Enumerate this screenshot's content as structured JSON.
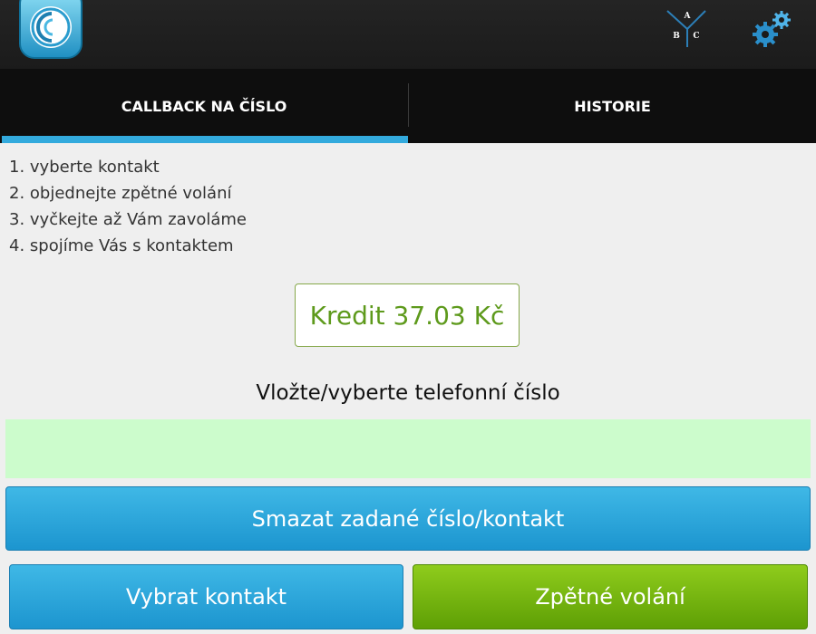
{
  "actionbar": {
    "logo_icon": "app-logo-icon",
    "abc_icon": "abc-contacts-icon",
    "abc_letters": [
      "A",
      "B",
      "C"
    ],
    "settings_icon": "gears-icon"
  },
  "tabs": [
    {
      "label": "CALLBACK NA ČÍSLO",
      "selected": true
    },
    {
      "label": "HISTORIE",
      "selected": false
    }
  ],
  "steps": [
    "1. vyberte kontakt",
    "2. objednejte zpětné volání",
    "3. vyčkejte až Vám zavoláme",
    "4. spojíme Vás s kontaktem"
  ],
  "credit": {
    "text": "Kredit 37.03 Kč"
  },
  "phone": {
    "prompt": "Vložte/vyberte telefonní číslo",
    "value": "",
    "placeholder": ""
  },
  "buttons": {
    "clear": "Smazat zadané číslo/kontakt",
    "select_contact": "Vybrat kontakt",
    "callback": "Zpětné volání"
  },
  "colors": {
    "accent": "#33aadd",
    "credit_green": "#5e9a1c",
    "input_bg": "#ccfccc",
    "callback_green": "#7ab80f"
  }
}
